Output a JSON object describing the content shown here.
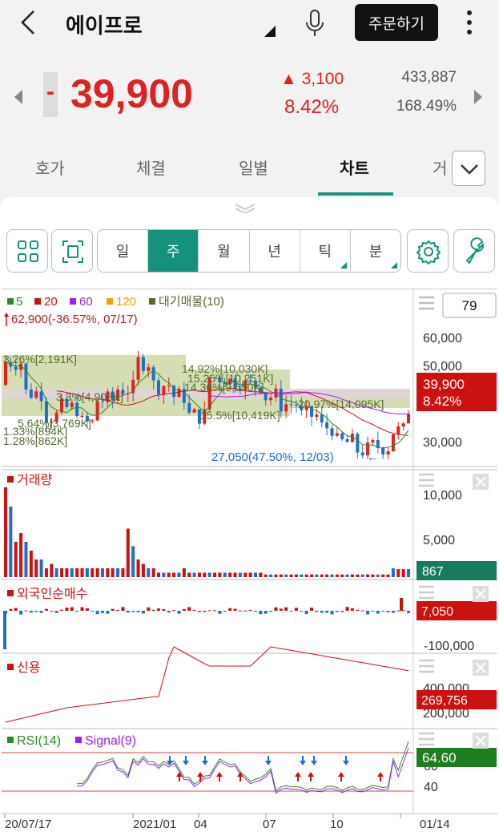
{
  "header": {
    "stock_name": "에이프로",
    "order_button": "주문하기"
  },
  "quote": {
    "sign": "-",
    "price": "39,900",
    "change": "▲ 3,100",
    "change_pct": "8.42%",
    "volume": "433,887",
    "volume_pct": "168.49%"
  },
  "tabs": [
    "호가",
    "체결",
    "일별",
    "차트",
    "거"
  ],
  "active_tab": "차트",
  "periods": [
    "일",
    "주",
    "월",
    "년",
    "틱",
    "분"
  ],
  "active_period": "주",
  "chart": {
    "legend": {
      "ma5": "5",
      "ma20": "20",
      "ma60": "60",
      "ma120": "120",
      "supply": "대기매물(10)"
    },
    "count_box": "79",
    "high_note": "62,900(-36.57%, 07/17)",
    "low_note": "27,050(47.50%, 12/03)",
    "supply_labels": [
      "3.26%[2,191K]",
      "3.3%[4,908K]",
      "5.64%[3,769K]",
      "1.33%[894K]",
      "1.28%[862K]",
      "14.92%[10,030K]",
      "15.25%[10,251K]",
      "14.36%[9,650K]",
      "15.5%[10,419K]",
      "20.97%[14,095K]"
    ],
    "price_axis": [
      "60,000",
      "50,000",
      "40,000",
      "30,000"
    ],
    "current_price_tag": "39,900",
    "current_pct_tag": "8.42%",
    "volume_title": "거래량",
    "volume_axis": [
      "10,000",
      "5,000"
    ],
    "volume_tag": "867",
    "foreign_title": "외국인순매수",
    "foreign_tag": "7,050",
    "foreign_axis": [
      "-100,000"
    ],
    "credit_title": "신용",
    "credit_axis": [
      "400,000",
      "200,000"
    ],
    "credit_tag": "269,756",
    "rsi_title": "RSI(14)",
    "signal_title": "Signal(9)",
    "rsi_axis": [
      "60",
      "40"
    ],
    "rsi_tag": "64.60",
    "x_labels": [
      "20/07/17",
      "2021/01",
      "04",
      "07",
      "10",
      "01/14"
    ]
  },
  "colors": {
    "accent": "#16917e",
    "up": "#dd2222",
    "down": "#1f6fc7",
    "ma5": "#2a8a2a",
    "ma20": "#cc1111",
    "ma60": "#a020f0",
    "ma120": "#f0a000",
    "supply": "#556b2f"
  },
  "icons": [
    "back-arrow-icon",
    "triangle-icon",
    "mic-icon",
    "more-vertical-icon",
    "chevron-left-icon",
    "chevron-right-icon",
    "chevron-down-icon",
    "grid-icon",
    "focus-frame-icon",
    "gear-icon",
    "wrench-icon",
    "close-icon",
    "menu-lines-icon"
  ]
}
